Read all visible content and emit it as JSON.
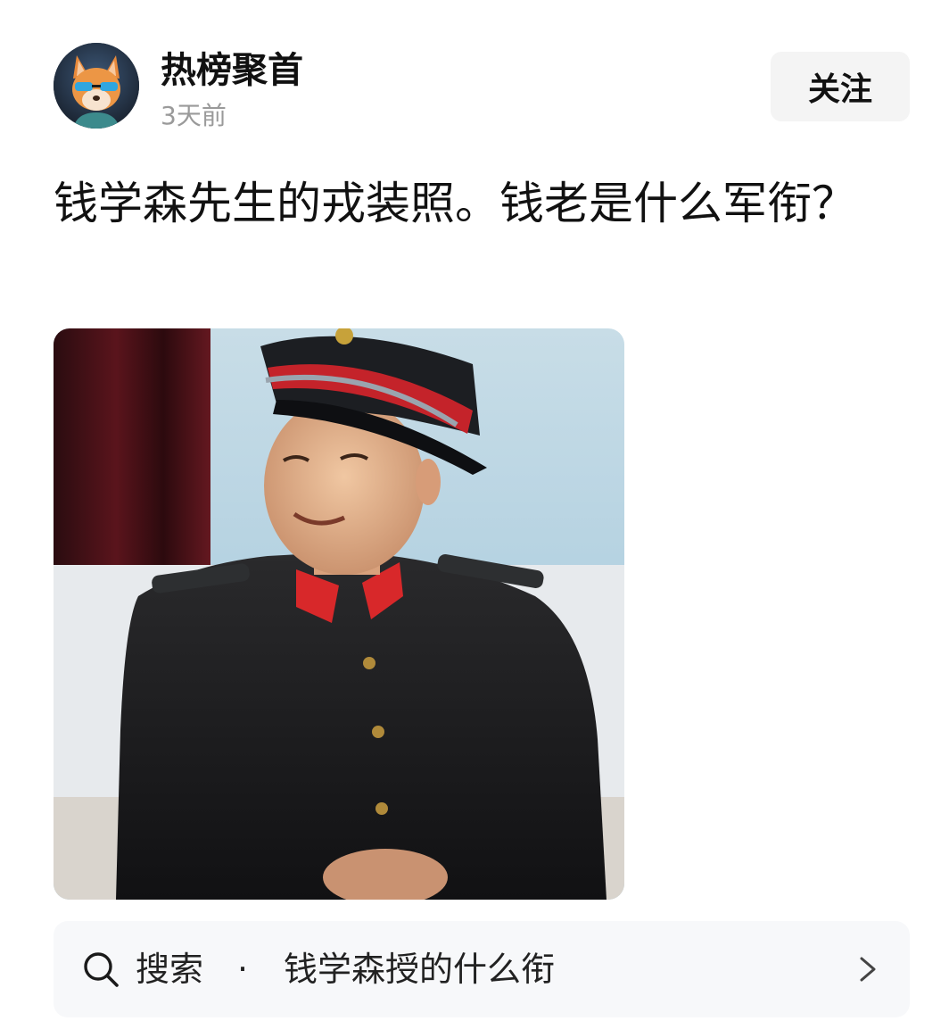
{
  "author": {
    "name": "热榜聚首",
    "time": "3天前",
    "avatar_icon": "fox-avatar-icon"
  },
  "follow": {
    "label": "关注"
  },
  "post": {
    "text": "钱学森先生的戎装照。钱老是什么军衔？",
    "image_icon": "portrait-photo"
  },
  "search_suggestion": {
    "label": "搜索",
    "separator": "·",
    "query": "钱学森授的什么衔",
    "icon": "search-icon",
    "arrow_icon": "chevron-right-icon"
  },
  "colors": {
    "background": "#ffffff",
    "follow_bg": "#f4f4f4",
    "search_bg": "#f7f8fa",
    "muted_text": "#9a9a9a",
    "primary_text": "#111111"
  }
}
